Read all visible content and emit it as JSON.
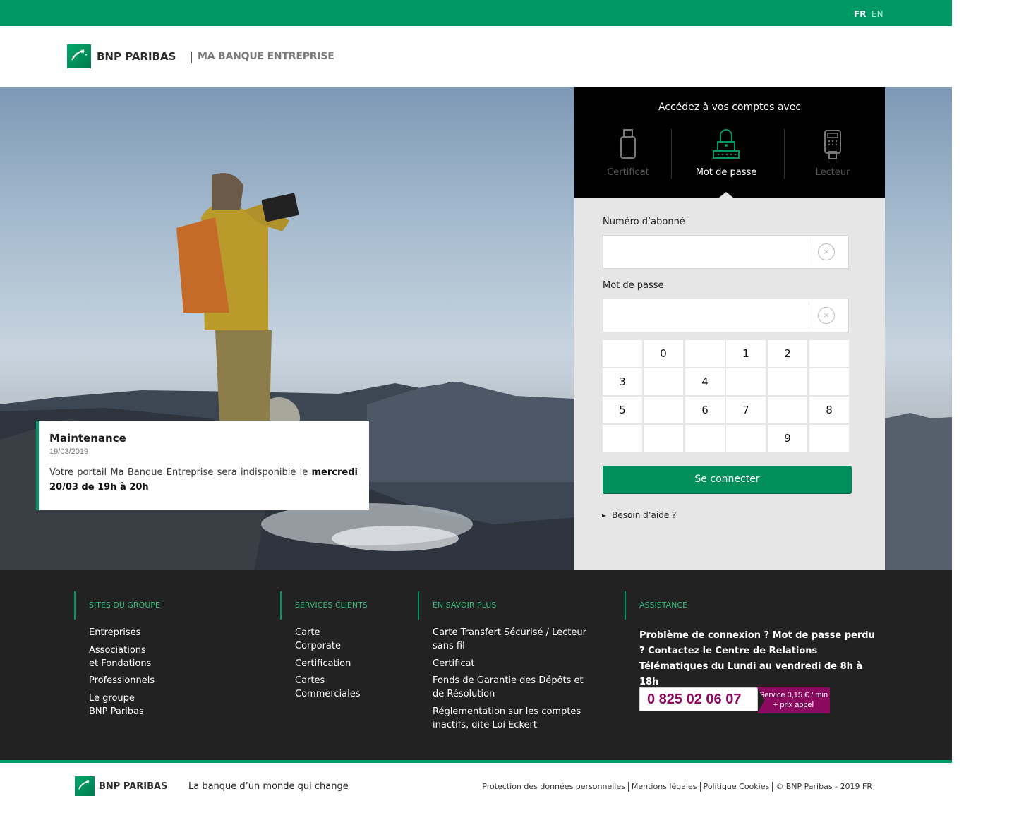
{
  "lang": {
    "fr": "FR",
    "en": "EN"
  },
  "brand": {
    "name": "BNP PARIBAS",
    "app": "MA BANQUE ENTREPRISE",
    "logo_icon": "stars-logo-icon",
    "color": "#009966"
  },
  "notice": {
    "title": "Maintenance",
    "date": "19/03/2019",
    "text_prefix": "Votre portail Ma Banque Entreprise sera indisponible le ",
    "text_bold": "mercredi 20/03 de 19h à 20h"
  },
  "login": {
    "title": "Accédez à vos comptes avec",
    "methods": [
      {
        "label": "Certificat",
        "icon": "usb-key-icon",
        "active": false
      },
      {
        "label": "Mot de passe",
        "icon": "padlock-icon",
        "active": true
      },
      {
        "label": "Lecteur",
        "icon": "card-reader-icon",
        "active": false
      }
    ],
    "subscriber_label": "Numéro d’abonné",
    "subscriber_value": "",
    "password_label": "Mot de passe",
    "password_value": "",
    "clear_icon": "clear-icon",
    "keypad": [
      [
        "",
        "0",
        "",
        "1",
        "2",
        ""
      ],
      [
        "3",
        "",
        "4",
        "",
        "",
        ""
      ],
      [
        "5",
        "",
        "6",
        "7",
        "",
        "8"
      ],
      [
        "",
        "",
        "",
        "",
        "9",
        ""
      ]
    ],
    "submit_label": "Se connecter",
    "help_label": "Besoin d’aide ?"
  },
  "footer": {
    "columns": [
      {
        "heading": "SITES DU GROUPE",
        "links": [
          "Entreprises",
          "Associations et Fondations",
          "Professionnels",
          "Le groupe BNP Paribas"
        ]
      },
      {
        "heading": "SERVICES CLIENTS",
        "links": [
          "Carte Corporate",
          "Certification",
          "Cartes Commerciales"
        ]
      },
      {
        "heading": "EN SAVOIR PLUS",
        "links": [
          "Carte Transfert Sécurisé / Lecteur sans fil",
          "Certificat",
          "Fonds de Garantie des Dépôts et de Résolution",
          "Réglementation sur les comptes inactifs, dite Loi Eckert"
        ]
      }
    ],
    "assistance": {
      "heading": "ASSISTANCE",
      "text": "Problème de connexion ? Mot de passe perdu ? Contactez le Centre de Relations Télématiques du Lundi au vendredi de 8h à 18h",
      "phone": "0 825 02 06 07",
      "phone_note": "Service 0,15 € / min + prix appel",
      "phone_color": "#8b0a60"
    }
  },
  "bottom": {
    "tagline": "La banque d’un monde qui change",
    "links": [
      "Protection des données personnelles",
      "Mentions légales",
      "Politique Cookies",
      "© BNP Paribas - 2019 FR"
    ]
  }
}
